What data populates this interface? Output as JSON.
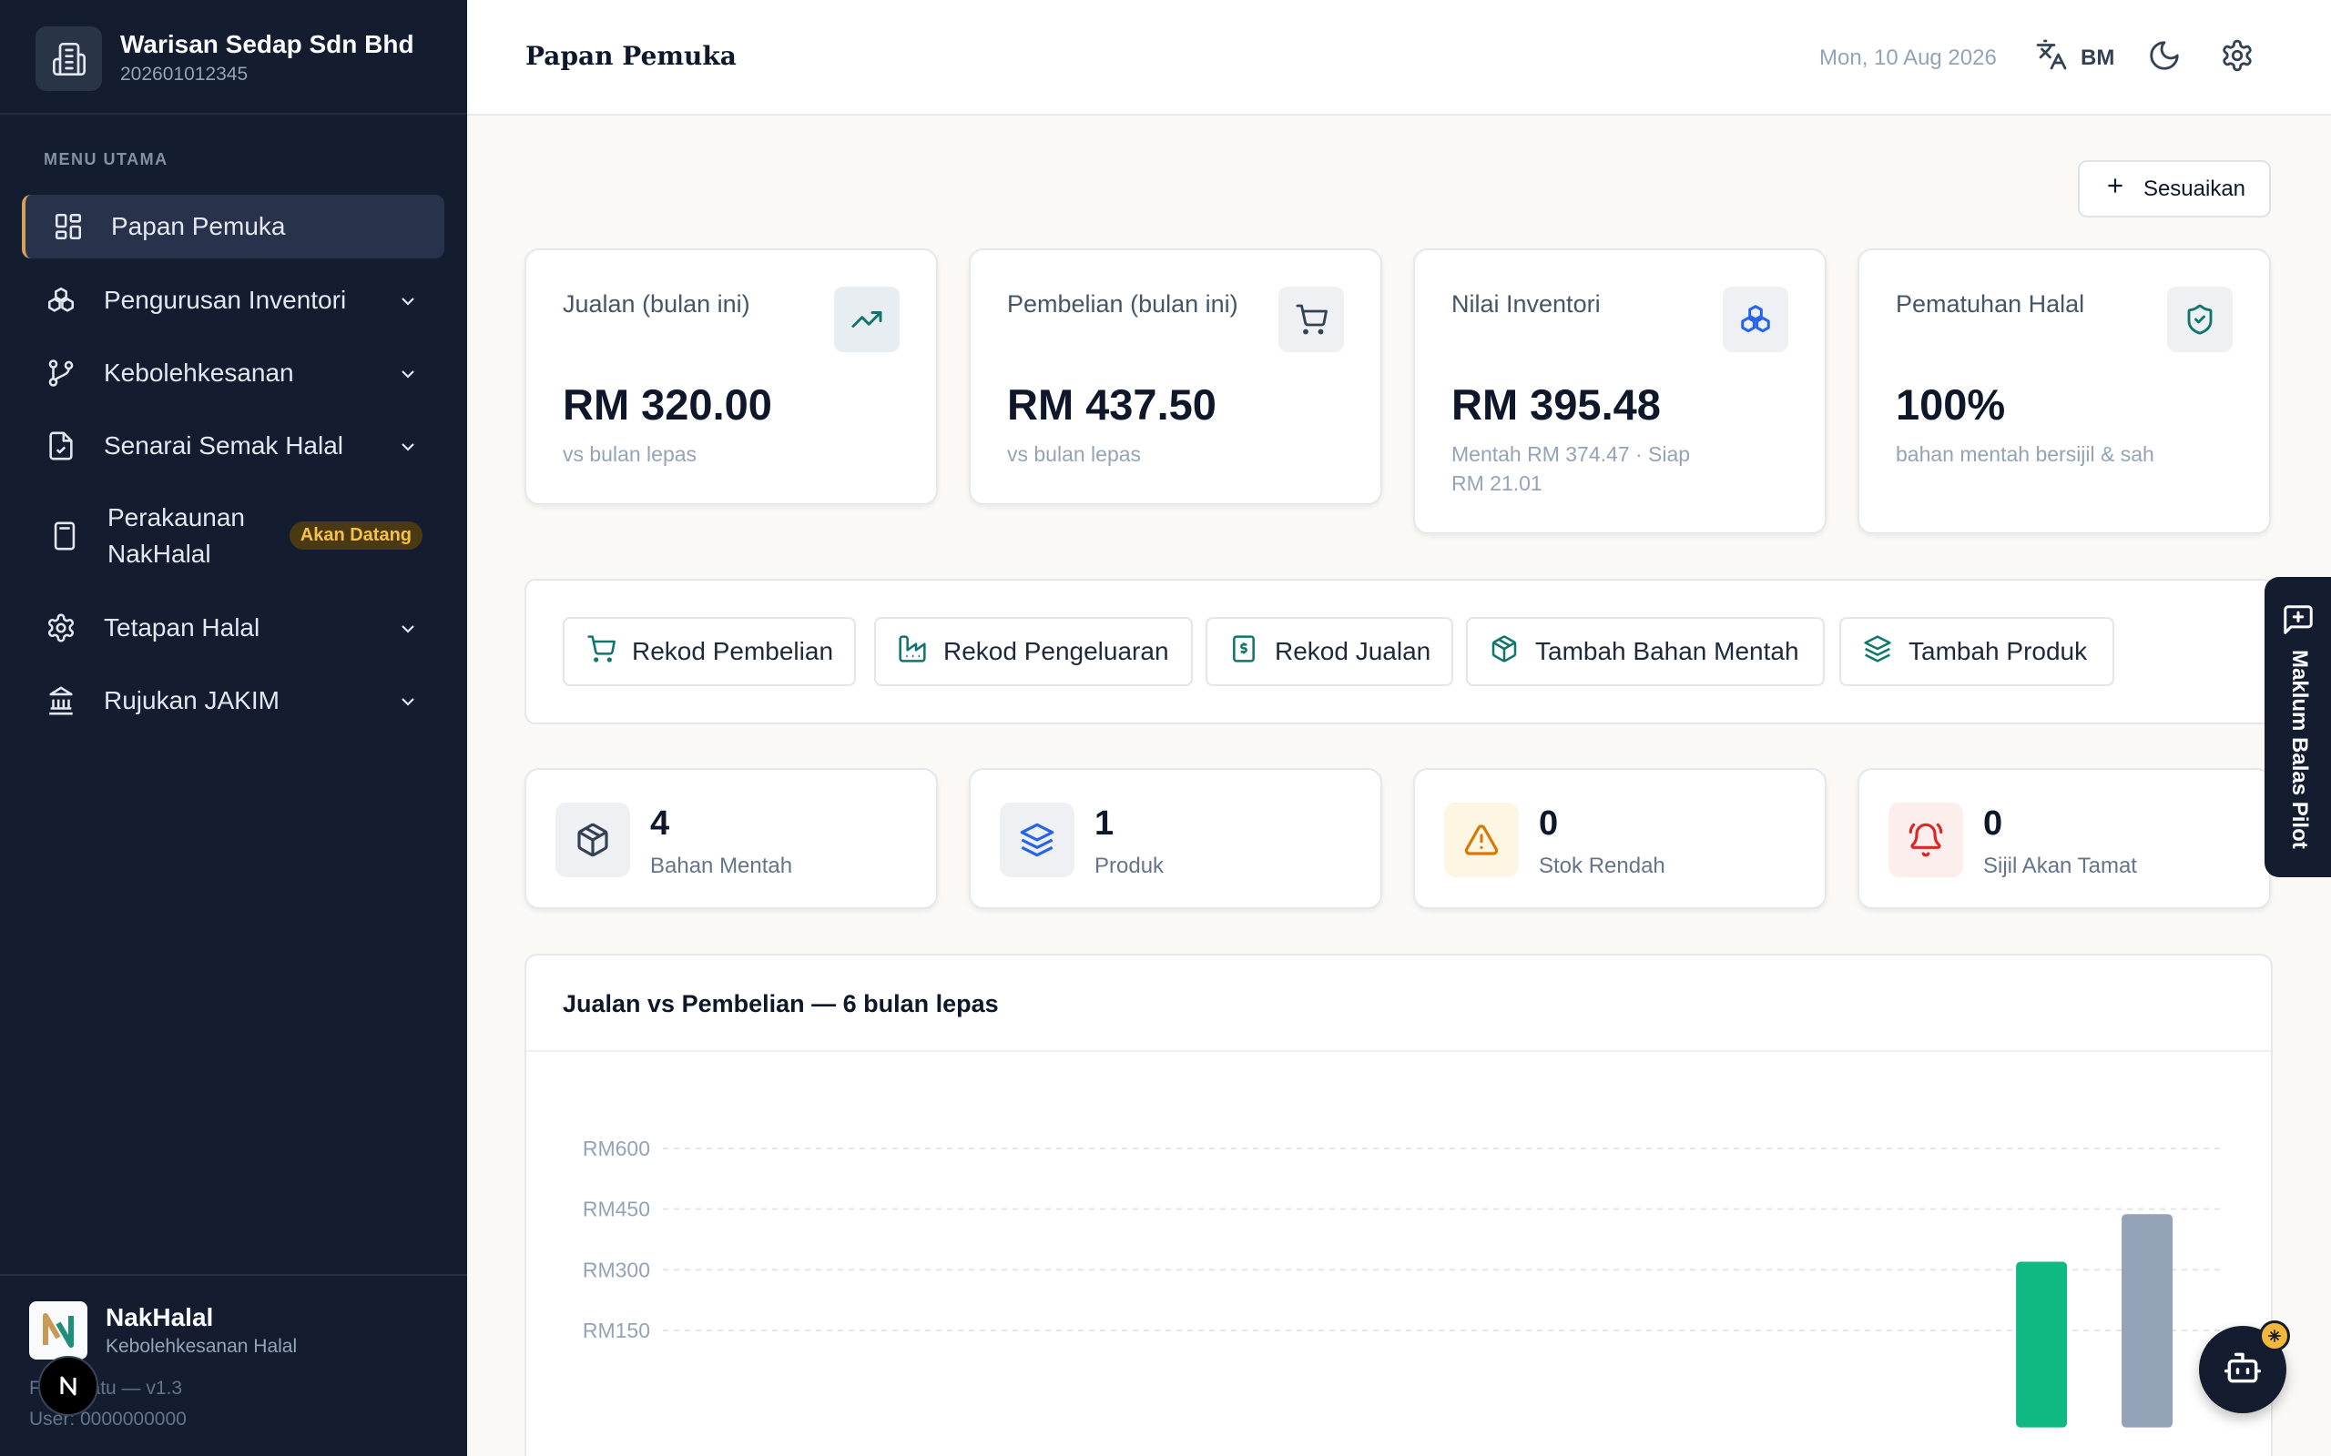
{
  "sidebar": {
    "org_name": "Warisan Sedap Sdn Bhd",
    "org_reg": "202601012345",
    "menu_title": "MENU UTAMA",
    "items": [
      {
        "label": "Papan Pemuka",
        "icon": "dashboard-icon",
        "active": true
      },
      {
        "label": "Pengurusan Inventori",
        "icon": "boxes-icon"
      },
      {
        "label": "Kebolehkesanan",
        "icon": "git-branch-icon"
      },
      {
        "label": "Senarai Semak Halal",
        "icon": "checklist-file-icon"
      },
      {
        "label": "Perakaunan NakHalal",
        "icon": "calculator-icon",
        "badge": "Akan Datang"
      },
      {
        "label": "Tetapan Halal",
        "icon": "gear-icon"
      },
      {
        "label": "Rujukan JAKIM",
        "icon": "landmark-icon"
      }
    ],
    "footer": {
      "app_name": "NakHalal",
      "app_sub": "Kebolehkesanan Halal",
      "version": "Fasa Satu — v1.3",
      "user": "User: 0000000000"
    }
  },
  "header": {
    "title": "Papan Pemuka",
    "date": "Mon, 10 Aug 2026",
    "lang": "BM"
  },
  "main": {
    "customize_label": "Sesuaikan",
    "stats": [
      {
        "label": "Jualan (bulan ini)",
        "value": "RM 320.00",
        "sub": "vs bulan lepas",
        "icon": "trending-up-icon"
      },
      {
        "label": "Pembelian (bulan ini)",
        "value": "RM 437.50",
        "sub": "vs bulan lepas",
        "icon": "cart-icon"
      },
      {
        "label": "Nilai Inventori",
        "value": "RM 395.48",
        "sub": "Mentah RM 374.47 · Siap RM 21.01",
        "icon": "boxes-icon"
      },
      {
        "label": "Pematuhan Halal",
        "value": "100%",
        "sub": "bahan mentah bersijil & sah",
        "icon": "shield-check-icon"
      }
    ],
    "quick_actions": [
      {
        "label": "Rekod Pembelian",
        "icon": "cart-icon"
      },
      {
        "label": "Rekod Pengeluaran",
        "icon": "factory-icon"
      },
      {
        "label": "Rekod Jualan",
        "icon": "receipt-icon"
      },
      {
        "label": "Tambah Bahan Mentah",
        "icon": "package-icon"
      },
      {
        "label": "Tambah Produk",
        "icon": "layers-icon"
      }
    ],
    "counts": [
      {
        "value": "4",
        "label": "Bahan Mentah",
        "icon": "package-icon"
      },
      {
        "value": "1",
        "label": "Produk",
        "icon": "layers-icon"
      },
      {
        "value": "0",
        "label": "Stok Rendah",
        "icon": "warning-icon"
      },
      {
        "value": "0",
        "label": "Sijil Akan Tamat",
        "icon": "alarm-bell-icon"
      }
    ]
  },
  "chart_data": {
    "type": "bar",
    "title": "Jualan vs Pembelian — 6 bulan lepas",
    "ylim": [
      0,
      600
    ],
    "yticks": [
      "RM600",
      "RM450",
      "RM300",
      "RM150"
    ],
    "ytick_values": [
      600,
      450,
      300,
      150
    ],
    "grid": true,
    "series": [
      {
        "values": [
          0,
          0,
          0,
          0,
          0,
          320
        ],
        "color": "#10b981"
      },
      {
        "values": [
          0,
          0,
          0,
          0,
          0,
          437.5
        ],
        "color": "#94a3b8"
      }
    ]
  },
  "floating": {
    "feedback_label": "Maklum Balas Pilot"
  },
  "colors": {
    "sidebar_bg": "#141d30",
    "accent": "#d4a05a",
    "sales": "#10b981",
    "purchases": "#94a3b8"
  }
}
